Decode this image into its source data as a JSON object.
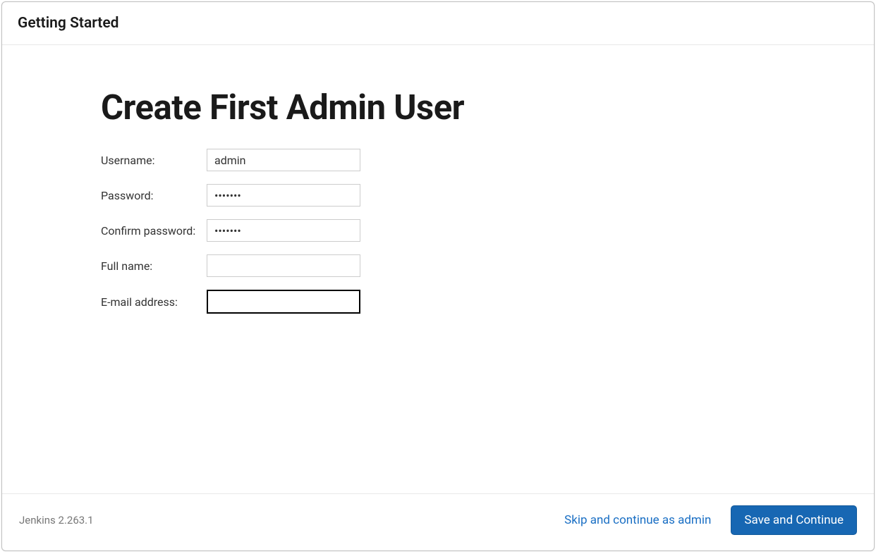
{
  "header": {
    "title": "Getting Started"
  },
  "main": {
    "title": "Create First Admin User",
    "form": {
      "username": {
        "label": "Username:",
        "value": "admin"
      },
      "password": {
        "label": "Password:",
        "value": "•••••••"
      },
      "confirm_password": {
        "label": "Confirm password:",
        "value": "•••••••"
      },
      "full_name": {
        "label": "Full name:",
        "value": ""
      },
      "email": {
        "label": "E-mail address:",
        "value": ""
      }
    }
  },
  "footer": {
    "version_text": "Jenkins 2.263.1",
    "skip_label": "Skip and continue as admin",
    "save_label": "Save and Continue"
  }
}
